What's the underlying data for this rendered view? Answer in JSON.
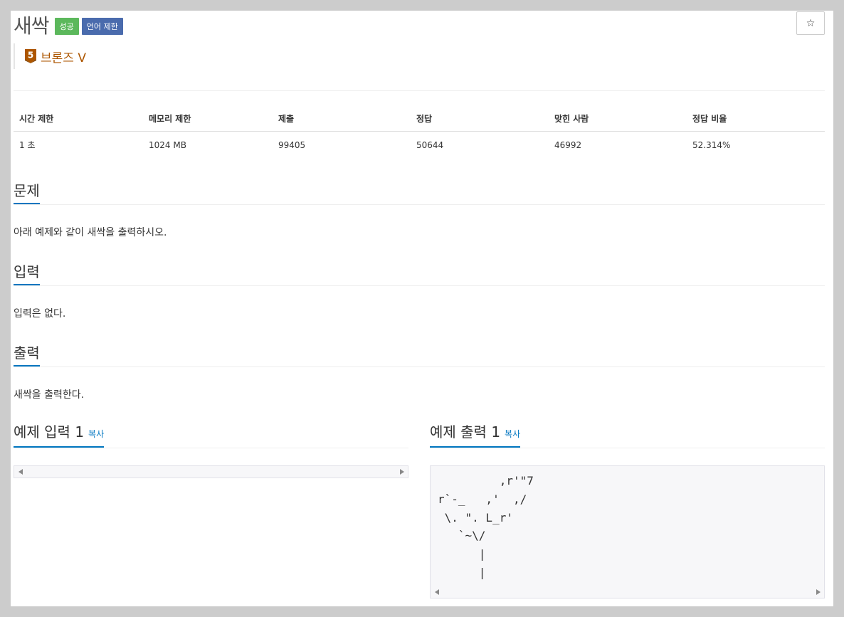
{
  "problem": {
    "title": "새싹",
    "badges": {
      "success": "성공",
      "language": "언어 제한"
    },
    "star": "☆",
    "tier": {
      "number": "5",
      "label": "브론즈 V",
      "color": "#ad5600"
    }
  },
  "stats": {
    "headers": [
      "시간 제한",
      "메모리 제한",
      "제출",
      "정답",
      "맞힌 사람",
      "정답 비율"
    ],
    "values": [
      "1 초",
      "1024 MB",
      "99405",
      "50644",
      "46992",
      "52.314%"
    ]
  },
  "sections": {
    "description": {
      "title": "문제",
      "body": "아래 예제와 같이 새싹을 출력하시오."
    },
    "input": {
      "title": "입력",
      "body": "입력은 없다."
    },
    "output": {
      "title": "출력",
      "body": "새싹을 출력한다."
    }
  },
  "samples": {
    "input": {
      "title": "예제 입력 1",
      "copy": "복사",
      "content": ""
    },
    "output": {
      "title": "예제 출력 1",
      "copy": "복사",
      "content": "         ,r'\"7\nr`-_   ,'  ,/\n \\. \". L_r'\n   `~\\/\n      |\n      |"
    }
  },
  "colors": {
    "accent": "#0076c0",
    "success": "#5cb85c",
    "lang_badge": "#4a6bad",
    "bronze": "#ad5600"
  }
}
